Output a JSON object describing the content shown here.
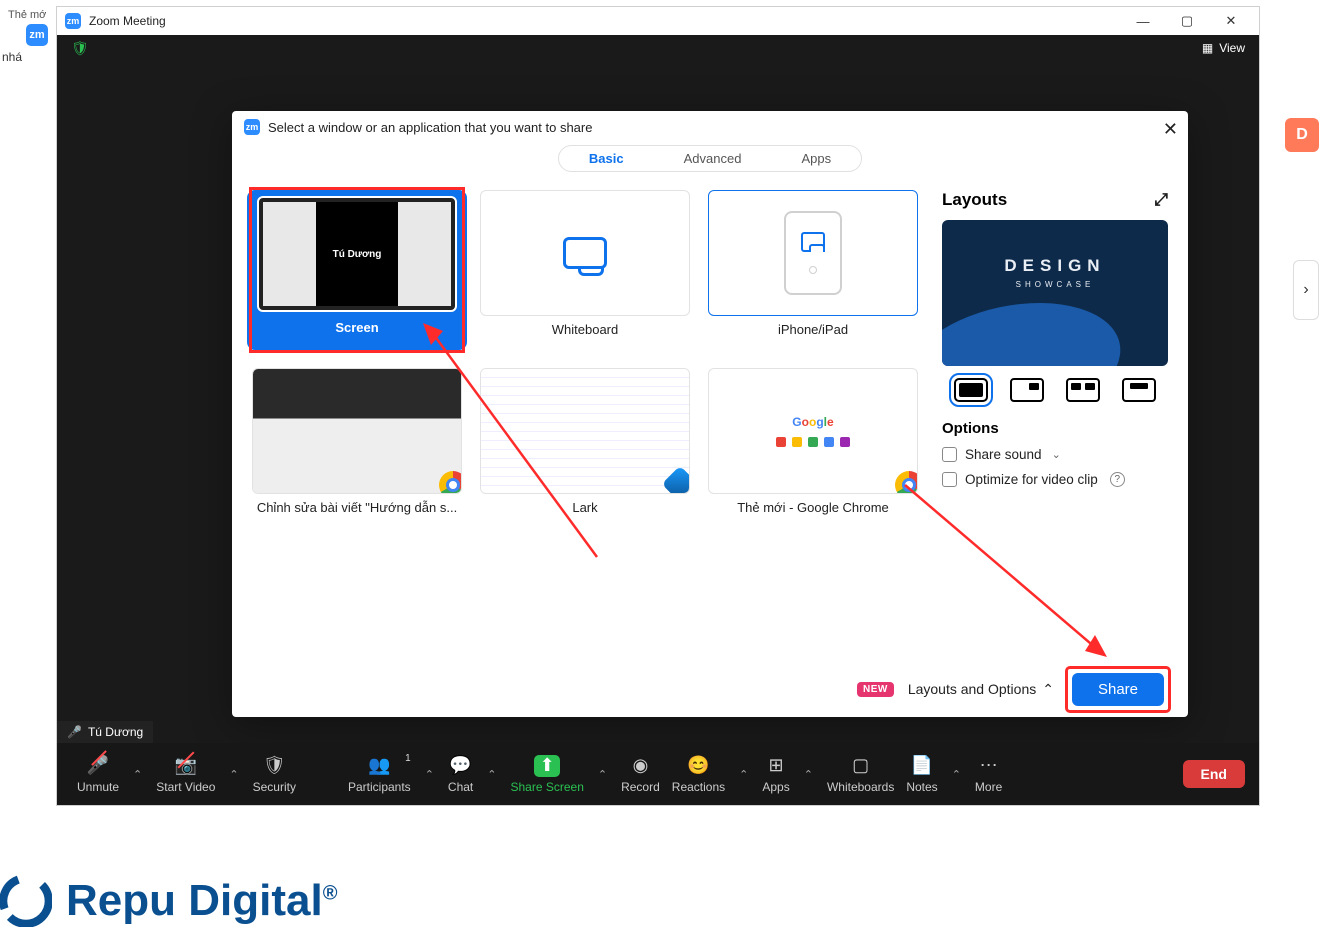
{
  "window": {
    "title": "Zoom Meeting"
  },
  "topbar": {
    "view": "View"
  },
  "nametag": {
    "user": "Tú Dương"
  },
  "dialog": {
    "title": "Select a window or an application that you want to share",
    "tabs": {
      "basic": "Basic",
      "advanced": "Advanced",
      "apps": "Apps"
    },
    "cards": {
      "screen": "Screen",
      "screen_user": "Tú Dương",
      "whiteboard": "Whiteboard",
      "ipad": "iPhone/iPad",
      "win1": "Chỉnh sửa bài viết \"Hướng dẫn s...",
      "win2": "Lark",
      "win3": "Thẻ mới - Google Chrome"
    },
    "right": {
      "layouts": "Layouts",
      "preview_title": "DESIGN",
      "preview_sub": "SHOWCASE",
      "options": "Options",
      "sound": "Share sound",
      "optimize": "Optimize for video clip"
    },
    "footer": {
      "new": "NEW",
      "layouts_options": "Layouts and Options",
      "share": "Share"
    }
  },
  "toolbar": {
    "unmute": "Unmute",
    "video": "Start Video",
    "security": "Security",
    "participants": "Participants",
    "participants_count": "1",
    "chat": "Chat",
    "share": "Share Screen",
    "record": "Record",
    "reactions": "Reactions",
    "apps": "Apps",
    "whiteboards": "Whiteboards",
    "notes": "Notes",
    "more": "More",
    "end": "End"
  },
  "brand": "Repu Digital",
  "stray": {
    "a": "nhá",
    "b": "Thẻ mớ"
  }
}
